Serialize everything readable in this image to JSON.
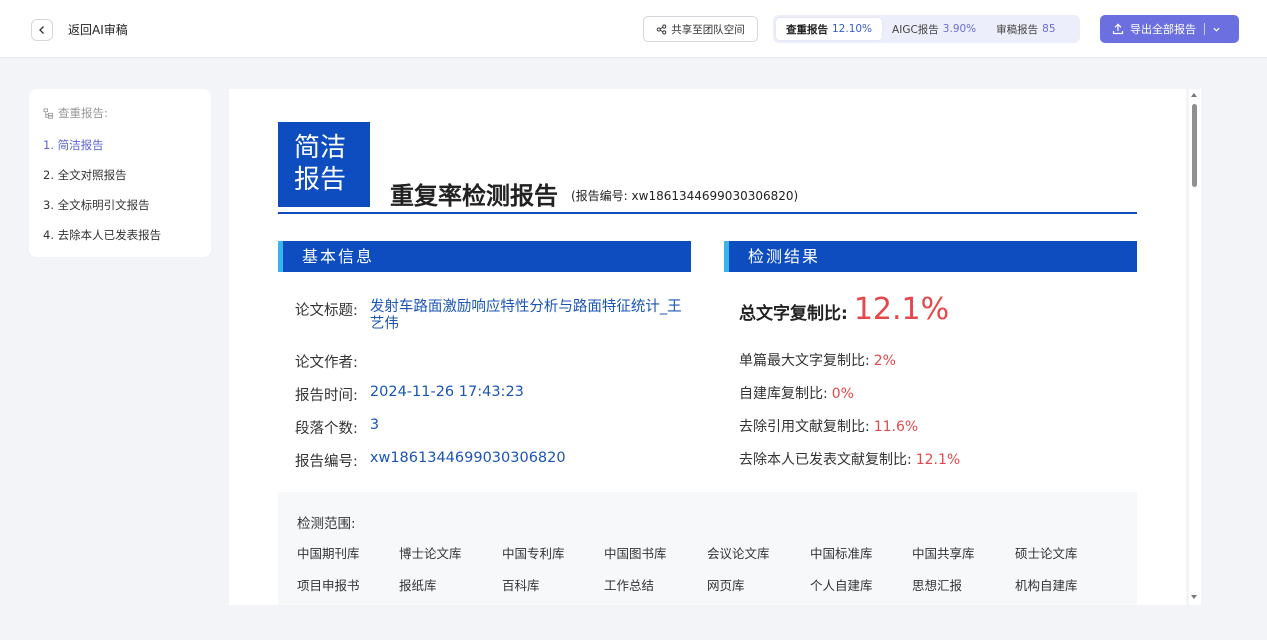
{
  "header": {
    "back_label": "返回AI审稿",
    "share_label": "共享至团队空间",
    "tabs": [
      {
        "label": "查重报告",
        "value": "12.10%"
      },
      {
        "label": "AIGC报告",
        "value": "3.90%"
      },
      {
        "label": "审稿报告",
        "value": "85"
      }
    ],
    "export_label": "导出全部报告"
  },
  "sidebar": {
    "title": "查重报告:",
    "items": [
      {
        "label": "1. 简洁报告"
      },
      {
        "label": "2. 全文对照报告"
      },
      {
        "label": "3. 全文标明引文报告"
      },
      {
        "label": "4. 去除本人已发表报告"
      }
    ]
  },
  "report": {
    "brand_line1": "简洁",
    "brand_line2": "报告",
    "title": "重复率检测报告",
    "number_note": "(报告编号: xw1861344699030306820)",
    "basic_info_heading": "基本信息",
    "result_heading": "检测结果",
    "info": {
      "title_label": "论文标题:",
      "title_value": "发射车路面激励响应特性分析与路面特征统计_王艺伟",
      "author_label": "论文作者:",
      "author_value": "",
      "time_label": "报告时间:",
      "time_value": "2024-11-26 17:43:23",
      "para_label": "段落个数:",
      "para_value": "3",
      "no_label": "报告编号:",
      "no_value": "xw1861344699030306820"
    },
    "results": {
      "total_label": "总文字复制比:",
      "total_value": "12.1%",
      "max_label": "单篇最大文字复制比:",
      "max_value": "2%",
      "self_db_label": "自建库复制比:",
      "self_db_value": "0%",
      "excl_cite_label": "去除引用文献复制比:",
      "excl_cite_value": "11.6%",
      "excl_self_label": "去除本人已发表文献复制比:",
      "excl_self_value": "12.1%"
    },
    "scope": {
      "title": "检测范围:",
      "row1": [
        "中国期刊库",
        "博士论文库",
        "中国专利库",
        "中国图书库",
        "会议论文库",
        "中国标准库",
        "中国共享库",
        "硕士论文库"
      ],
      "row2": [
        "项目申报书",
        "报纸库",
        "百科库",
        "工作总结",
        "网页库",
        "个人自建库",
        "思想汇报",
        "机构自建库"
      ]
    }
  },
  "colors": {
    "accent": "#6c6fe0",
    "report_blue": "#0d4dbf",
    "highlight_red": "#e5474b"
  }
}
